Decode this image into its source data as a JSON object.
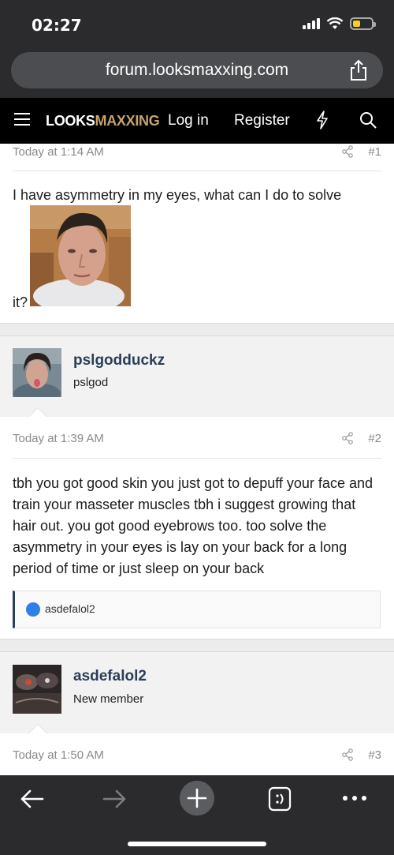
{
  "status": {
    "time": "02:27"
  },
  "browser": {
    "url": "forum.looksmaxxing.com"
  },
  "header": {
    "logo_part1": "LOOKS",
    "logo_part2": "MAXXING",
    "login": "Log in",
    "register": "Register"
  },
  "posts": [
    {
      "timestamp": "Today at 1:14 AM",
      "number": "#1",
      "text_line1": "I have asymmetry in my eyes, what can I do to solve",
      "text_line2": "it?"
    },
    {
      "username": "pslgodduckz",
      "user_title": "pslgod",
      "timestamp": "Today at 1:39 AM",
      "number": "#2",
      "text": "tbh you got good skin you just got to depuff your face and train your masseter muscles tbh i suggest growing that hair out. you got good eyebrows too. too solve the asymmetry in your eyes is lay on your back for a long period of time or just sleep on your back",
      "reaction_user": "asdefalol2"
    },
    {
      "username": "asdefalol2",
      "user_title": "New member",
      "timestamp": "Today at 1:50 AM",
      "number": "#3"
    }
  ],
  "colors": {
    "logo_accent": "#c7a36b",
    "username": "#2b3e57",
    "battery": "#f6d21a"
  }
}
